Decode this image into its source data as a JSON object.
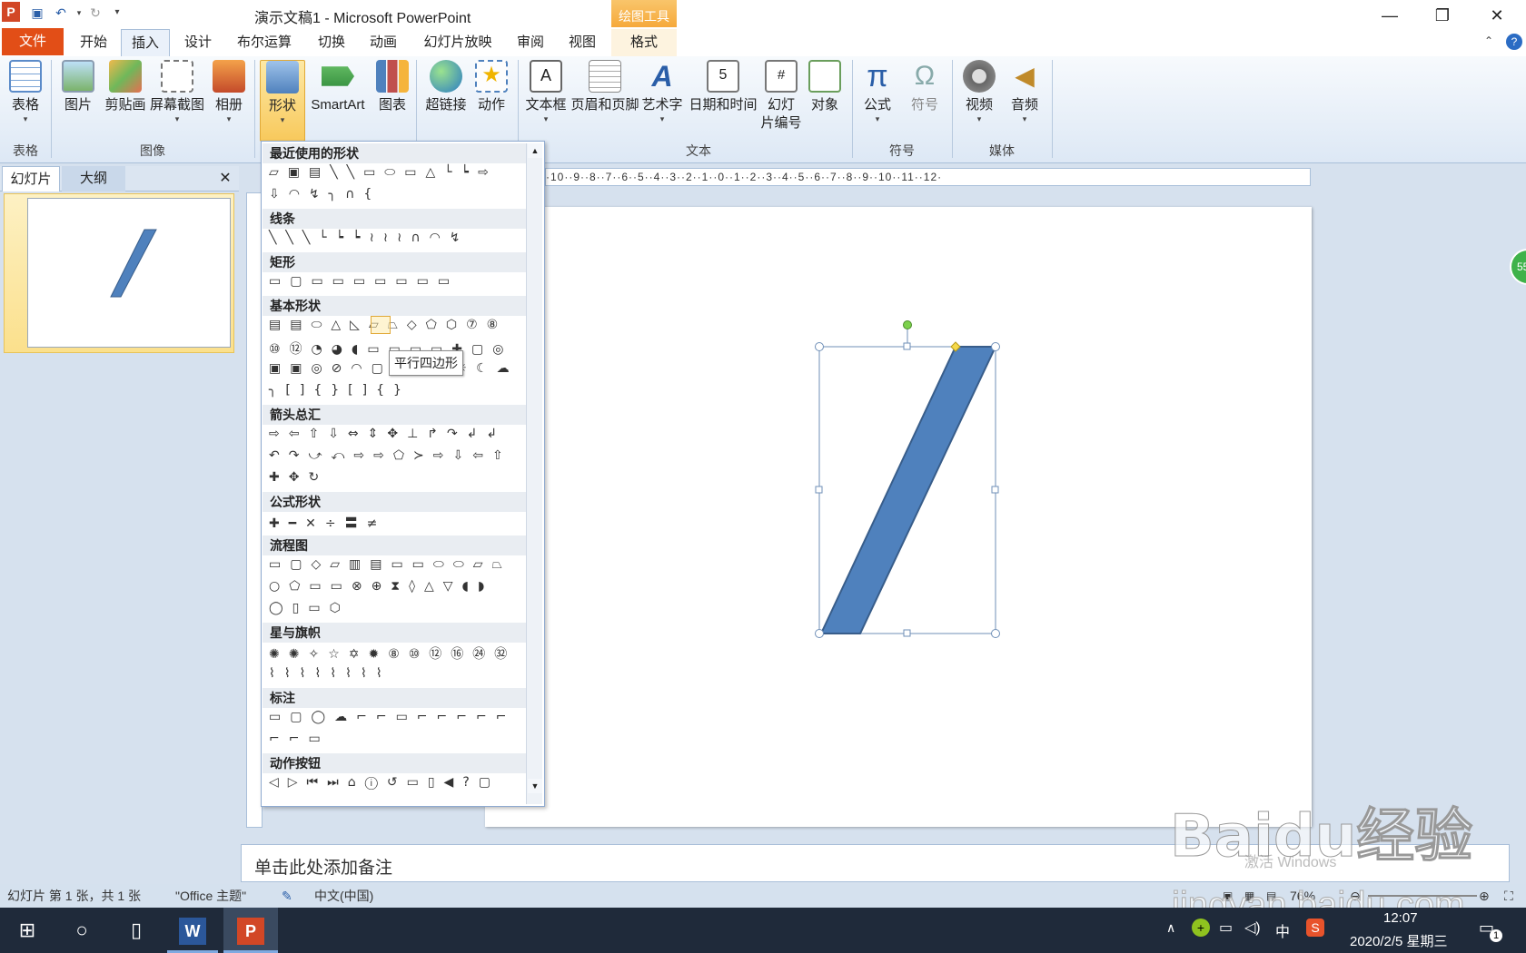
{
  "titlebar": {
    "title": "演示文稿1 - Microsoft PowerPoint",
    "context_tool": "绘图工具",
    "app_icon": "P",
    "minimize": "—",
    "restore": "❐",
    "close": "✕"
  },
  "tabs": {
    "file": "文件",
    "items": [
      "开始",
      "插入",
      "设计",
      "布尔运算",
      "切换",
      "动画",
      "幻灯片放映",
      "审阅",
      "视图",
      "格式"
    ]
  },
  "ribbon": {
    "buttons": [
      "表格",
      "图片",
      "剪贴画",
      "屏幕截图",
      "相册",
      "形状",
      "SmartArt",
      "图表",
      "超链接",
      "动作",
      "文本框",
      "页眉和页脚",
      "艺术字",
      "日期和时间",
      "幻灯片编号",
      "对象",
      "公式",
      "符号",
      "视频",
      "音频"
    ],
    "slide_number_line2": "片编号",
    "slide_number_line1": "幻灯",
    "groups": [
      "表格",
      "图像",
      "文本",
      "符号",
      "媒体"
    ]
  },
  "left_pane": {
    "tab_slides": "幻灯片",
    "tab_outline": "大纲",
    "close": "✕",
    "slide_number": "1"
  },
  "gallery": {
    "sections": [
      "最近使用的形状",
      "线条",
      "矩形",
      "基本形状",
      "箭头总汇",
      "公式形状",
      "流程图",
      "星与旗帜",
      "标注",
      "动作按钮"
    ],
    "tooltip": "平行四边形"
  },
  "ruler": {
    "text": "·10··9··8··7··6··5··4··3··2··1··0··1··2··3··4··5··6··7··8··9··10··11··12·"
  },
  "notes": {
    "placeholder": "单击此处添加备注"
  },
  "statusbar": {
    "slide_info": "幻灯片 第 1 张，共 1 张",
    "theme": "\"Office 主题\"",
    "language": "中文(中国)",
    "zoom": "76%"
  },
  "taskbar": {
    "time": "12:07",
    "date": "2020/2/5 星期三",
    "ime": "中",
    "notification_count": "1"
  },
  "side_badge": "55",
  "watermark": {
    "line1": "Baidu经验",
    "line2": "jingyan.baidu.com",
    "activate": "激活 Windows"
  },
  "colors": {
    "shape_fill": "#4f81bd",
    "shape_stroke": "#385d8a",
    "file_tab": "#e24e17",
    "context_tab": "#f6a93b"
  }
}
